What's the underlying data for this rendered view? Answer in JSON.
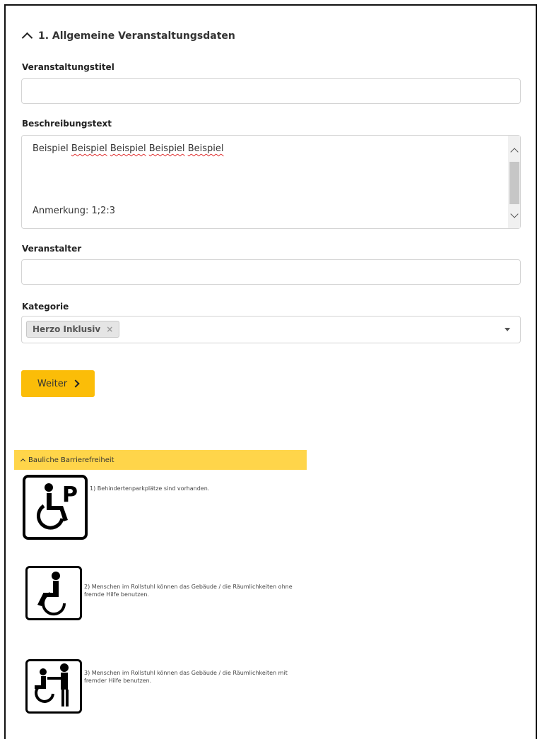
{
  "section": {
    "title": "1. Allgemeine Veranstaltungsdaten"
  },
  "fields": {
    "title_label": "Veranstaltungstitel",
    "title_value": "",
    "description_label": "Beschreibungstext",
    "description_line1_word1": "Beispiel",
    "description_line1_spelling": [
      "Beispiel",
      "Beispiel",
      "Beispiel",
      "Beispiel"
    ],
    "description_line2": "Anmerkung: 1;2:3",
    "organizer_label": "Veranstalter",
    "organizer_value": "",
    "category_label": "Kategorie",
    "category_selected": "Herzo Inklusiv",
    "category_remove": "×"
  },
  "actions": {
    "next_label": "Weiter"
  },
  "accessibility": {
    "heading": "Bauliche Barrierefreiheit",
    "items": [
      {
        "icon": "parking-accessible-icon",
        "text": "1) Behindertenparkplätze sind vorhanden."
      },
      {
        "icon": "wheelchair-icon",
        "text": "2) Menschen im Rollstuhl können das Gebäude / die Räumlichkeiten ohne fremde Hilfe benutzen."
      },
      {
        "icon": "wheelchair-assisted-icon",
        "text": "3) Menschen im Rollstuhl können das Gebäude / die Räumlichkeiten mit fremder Hilfe benutzen."
      }
    ]
  },
  "colors": {
    "accent": "#fbbd08",
    "accordion": "#ffd54a",
    "spellcheck": "#e03030"
  }
}
